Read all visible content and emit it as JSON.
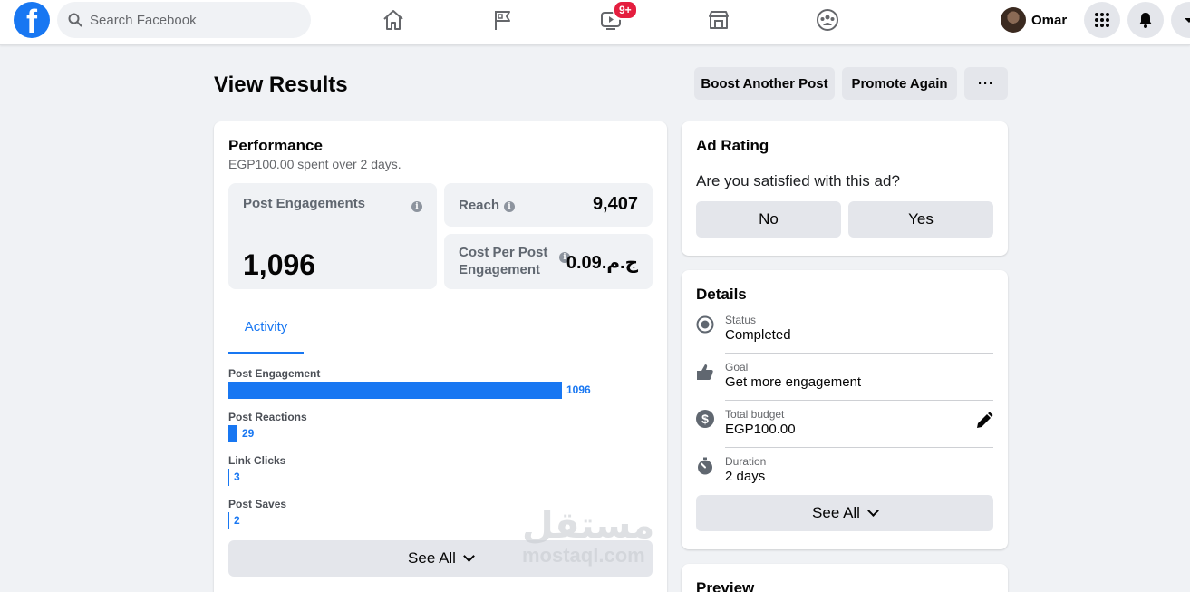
{
  "app": {
    "logo_letter": "f",
    "search_placeholder": "Search Facebook",
    "watch_badge": "9+",
    "user_name": "Omar"
  },
  "header": {
    "title": "View Results",
    "boost_label": "Boost Another Post",
    "promote_label": "Promote Again",
    "more_label": "···"
  },
  "performance": {
    "title": "Performance",
    "spent_prefix": "EGP100.00",
    "spent_middle": " spent over ",
    "spent_days": "2 days.",
    "engagements_label": "Post Engagements",
    "engagements_value": "1,096",
    "reach_label": "Reach",
    "reach_value": "9,407",
    "cpe_label_1": "Cost Per Post",
    "cpe_label_2": "Engagement",
    "cpe_value": "ج.م.0.09",
    "info_glyph": "i",
    "tab_activity": "Activity",
    "see_all": "See All"
  },
  "chart_data": {
    "type": "bar",
    "categories": [
      "Post Engagement",
      "Post Reactions",
      "Link Clicks",
      "Post Saves"
    ],
    "values": [
      1096,
      29,
      3,
      2
    ],
    "value_labels": [
      "1096",
      "29",
      "3",
      "2"
    ]
  },
  "ad_rating": {
    "title": "Ad Rating",
    "question": "Are you satisfied with this ad?",
    "no_label": "No",
    "yes_label": "Yes"
  },
  "details": {
    "title": "Details",
    "status_key": "Status",
    "status_val": "Completed",
    "goal_key": "Goal",
    "goal_val": "Get more engagement",
    "budget_key": "Total budget",
    "budget_val": "EGP100.00",
    "duration_key": "Duration",
    "duration_val": "2 days",
    "see_all": "See All"
  },
  "preview": {
    "title": "Preview"
  },
  "watermark": {
    "arabic": "مستقل",
    "latin": "mostaql.com"
  },
  "colors": {
    "accent": "#1877f2",
    "bar": "#1877f2",
    "badge": "#e41e3f"
  }
}
